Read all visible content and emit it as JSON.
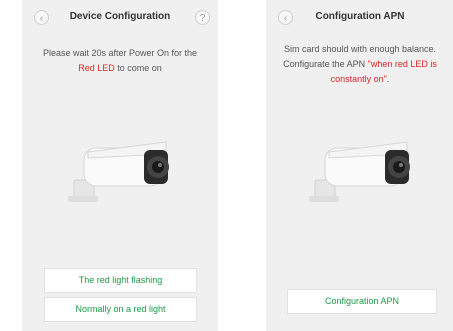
{
  "screen1": {
    "title": "Device Configuration",
    "back_icon": "chevron-left-icon",
    "help_label": "?",
    "desc_line1": "Please wait 20s after Power On for the",
    "desc_red": "Red LED",
    "desc_tail": " to come on",
    "button1": "The red light flashing",
    "button2": "Normally on a red light"
  },
  "screen2": {
    "title": "Configuration APN",
    "back_icon": "chevron-left-icon",
    "desc_line1": "Sim card should with enough balance.",
    "desc_line2_a": "Configurate the APN ",
    "desc_line2_red": "\"when red LED is",
    "desc_line3_red": "constantly on\"",
    "desc_line3_tail": ".",
    "button": "Configuration APN"
  },
  "colors": {
    "accent_green": "#1f9a49",
    "alert_red": "#e02424",
    "background": "#f0f0f0"
  }
}
